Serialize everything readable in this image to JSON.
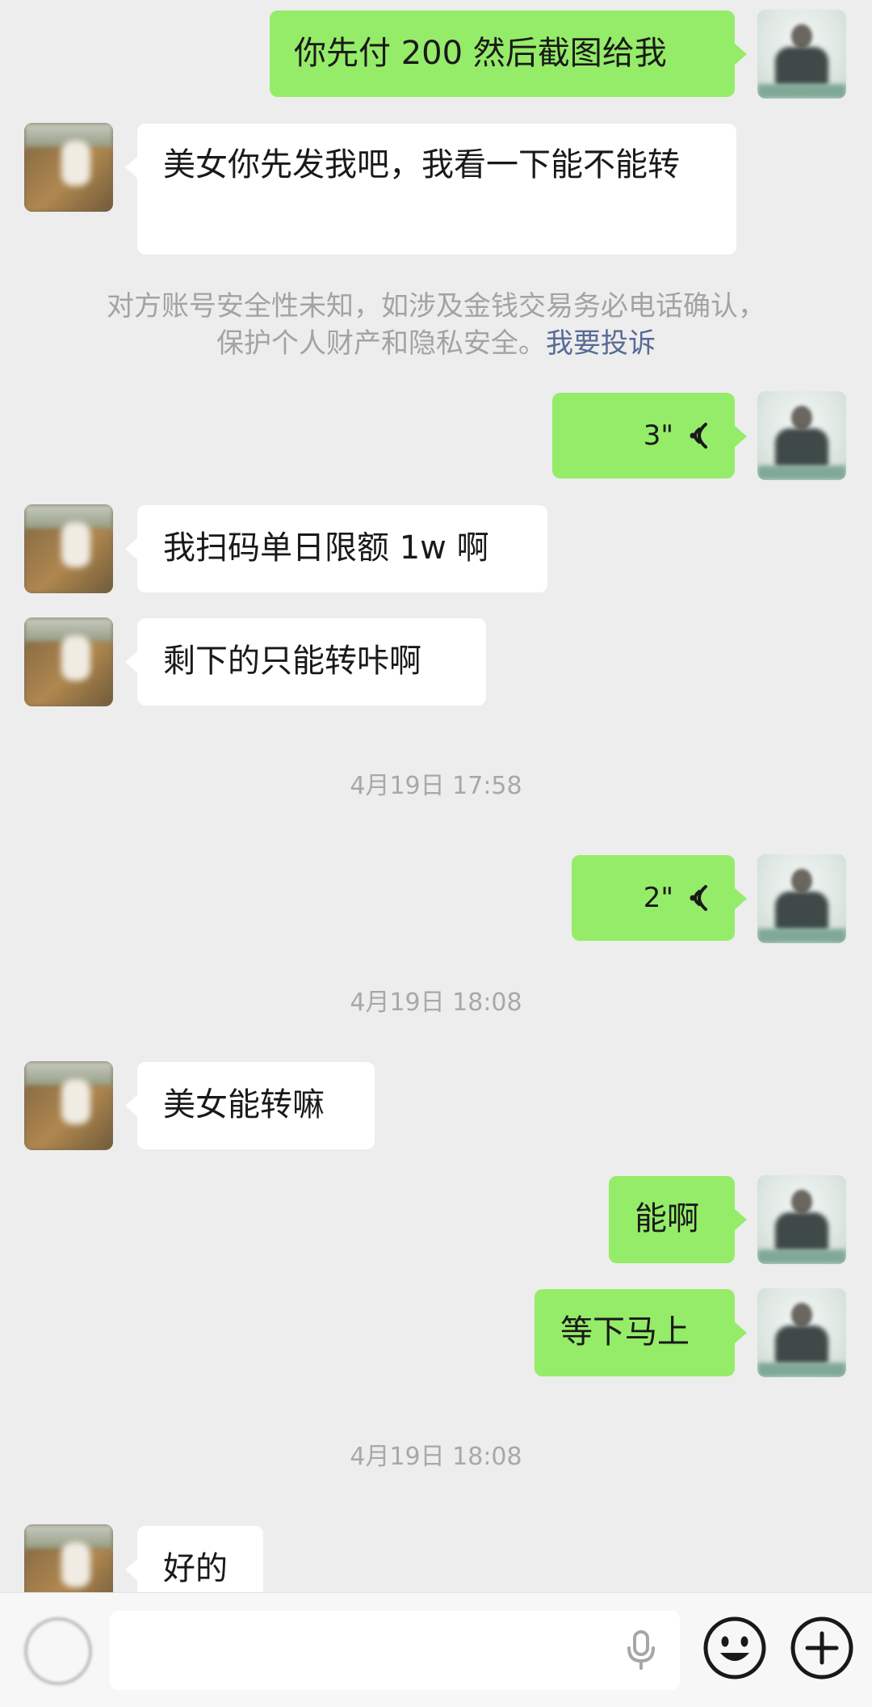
{
  "messages": {
    "m1": "你先付 200 然后截图给我",
    "m2": "美女你先发我吧，我看一下能不能转",
    "m3_duration": "3\"",
    "m4": "我扫码单日限额 1w 啊",
    "m5": "剩下的只能转咔啊",
    "m6_duration": "2\"",
    "m7": "美女能转嘛",
    "m8": "能啊",
    "m9": "等下马上",
    "m10": "好的"
  },
  "system_notice": {
    "text_line1": "对方账号安全性未知，如涉及金钱交易务必电话确认，",
    "text_line2": "保护个人财产和隐私安全。",
    "link": "我要投诉"
  },
  "timestamps": {
    "t1": "4月19日 17:58",
    "t2": "4月19日 18:08",
    "t3": "4月19日 18:08"
  },
  "colors": {
    "outgoing_bubble": "#95ec69",
    "incoming_bubble": "#ffffff",
    "background": "#ededed",
    "link": "#576b95"
  },
  "icons": {
    "voice_toggle": "voice-toggle-icon",
    "mic": "microphone-icon",
    "emoji": "emoji-icon",
    "more": "plus-icon",
    "voice_wave": "voice-wave-icon"
  }
}
